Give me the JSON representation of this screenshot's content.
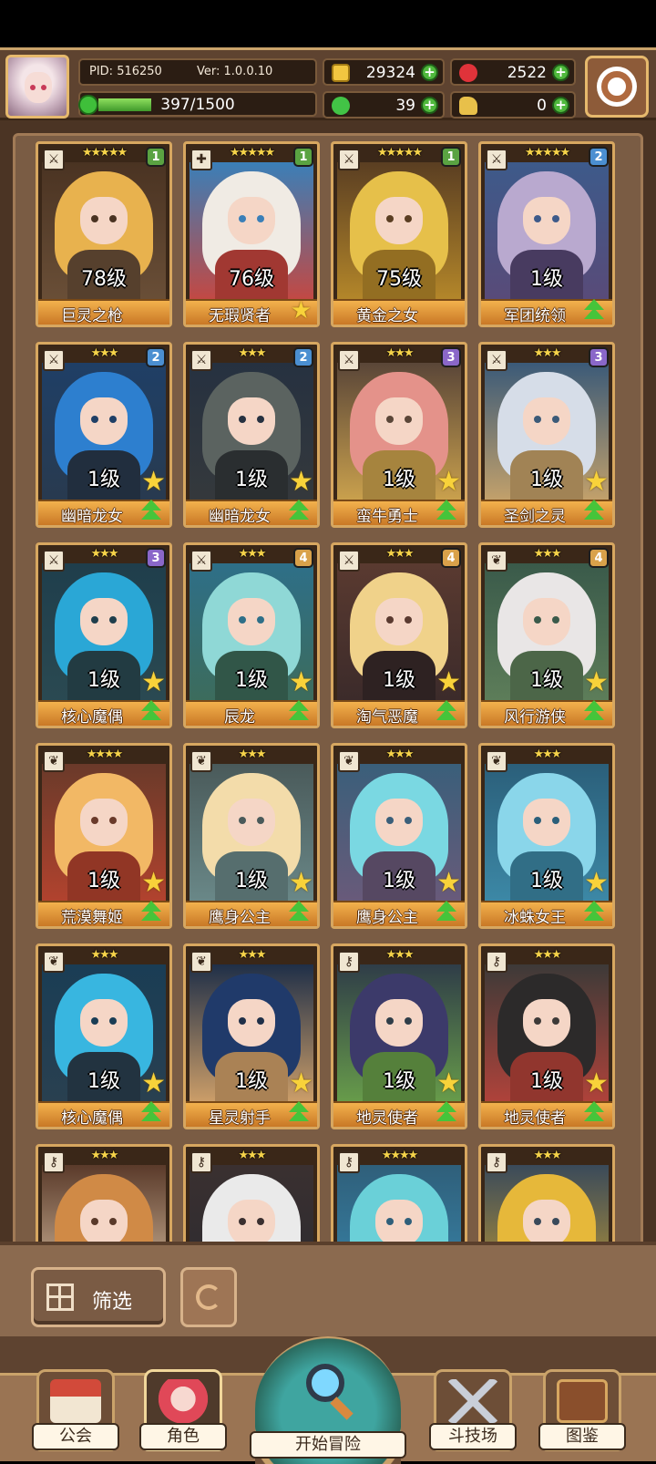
{
  "header": {
    "pid_label": "PID: 516250",
    "version_label": "Ver: 1.0.0.10",
    "xp": "397/1500",
    "xp_fraction": 0.265,
    "gold": "29324",
    "gems": "2522",
    "clover": "39",
    "fist": "0"
  },
  "cards": [
    {
      "name": "巨灵之枪",
      "level": "78级",
      "stars": "★★★★★",
      "rank": "1",
      "rank_color": "#5aa342",
      "type": "sword-icon",
      "palette": [
        "#4a3322",
        "#e8b24e",
        "#6b5038"
      ],
      "badge": "none"
    },
    {
      "name": "无瑕贤者",
      "level": "76级",
      "stars": "★★★★★",
      "rank": "1",
      "rank_color": "#5aa342",
      "type": "cross-icon",
      "palette": [
        "#3a7fb8",
        "#f0ebe4",
        "#c9463e"
      ],
      "badge": "crown"
    },
    {
      "name": "黄金之女",
      "level": "75级",
      "stars": "★★★★★",
      "rank": "1",
      "rank_color": "#5aa342",
      "type": "sword-icon",
      "palette": [
        "#5a3e22",
        "#e6c04a",
        "#b88a2a"
      ],
      "badge": "none"
    },
    {
      "name": "军团统领",
      "level": "1级",
      "stars": "★★★★★",
      "rank": "2",
      "rank_color": "#4b8fd1",
      "type": "sword-icon",
      "palette": [
        "#3d5a8a",
        "#b9a9cf",
        "#5a4a78"
      ],
      "badge": "up"
    },
    {
      "name": "幽暗龙女",
      "level": "1级",
      "stars": "★★★",
      "rank": "2",
      "rank_color": "#4b8fd1",
      "type": "sword-icon",
      "palette": [
        "#1f3f66",
        "#2d7fcf",
        "#293a4e"
      ],
      "badge": "both"
    },
    {
      "name": "幽暗龙女",
      "level": "1级",
      "stars": "★★★",
      "rank": "2",
      "rank_color": "#4b8fd1",
      "type": "sword-icon",
      "palette": [
        "#263140",
        "#5b6360",
        "#35393c"
      ],
      "badge": "both"
    },
    {
      "name": "蛮牛勇士",
      "level": "1级",
      "stars": "★★★",
      "rank": "3",
      "rank_color": "#8a67c9",
      "type": "sword-icon",
      "palette": [
        "#5a4638",
        "#e4928a",
        "#cfa54e"
      ],
      "badge": "both"
    },
    {
      "name": "圣剑之灵",
      "level": "1级",
      "stars": "★★★",
      "rank": "3",
      "rank_color": "#8a67c9",
      "type": "sword-icon",
      "palette": [
        "#3b5a78",
        "#d6dde8",
        "#c9a46a"
      ],
      "badge": "both"
    },
    {
      "name": "核心魔偶",
      "level": "1级",
      "stars": "★★★",
      "rank": "3",
      "rank_color": "#8a67c9",
      "type": "sword-icon",
      "palette": [
        "#1f3e4c",
        "#2aa7d6",
        "#2b4a52"
      ],
      "badge": "both"
    },
    {
      "name": "辰龙",
      "level": "1级",
      "stars": "★★★",
      "rank": "4",
      "rank_color": "#d9a14a",
      "type": "sword-icon",
      "palette": [
        "#2e6f88",
        "#8fd8d6",
        "#3d6c5a"
      ],
      "badge": "both"
    },
    {
      "name": "淘气恶魔",
      "level": "1级",
      "stars": "★★★",
      "rank": "4",
      "rank_color": "#d9a14a",
      "type": "sword-icon",
      "palette": [
        "#5a3a30",
        "#f0d28a",
        "#3a2a2a"
      ],
      "badge": "both"
    },
    {
      "name": "风行游侠",
      "level": "1级",
      "stars": "★★★",
      "rank": "4",
      "rank_color": "#d9a14a",
      "type": "leaf-icon",
      "palette": [
        "#3a5a4a",
        "#e9e6e6",
        "#5f7f5a"
      ],
      "badge": "both"
    },
    {
      "name": "荒漠舞姬",
      "level": "1级",
      "stars": "★★★★",
      "rank": "",
      "rank_color": "",
      "type": "leaf-icon",
      "palette": [
        "#6a3a2a",
        "#f2b865",
        "#b5432e"
      ],
      "badge": "both"
    },
    {
      "name": "鹰身公主",
      "level": "1级",
      "stars": "★★★",
      "rank": "",
      "rank_color": "",
      "type": "leaf-icon",
      "palette": [
        "#4a5a5a",
        "#f3dcaa",
        "#6b8a8a"
      ],
      "badge": "both"
    },
    {
      "name": "鹰身公主",
      "level": "1级",
      "stars": "★★★",
      "rank": "",
      "rank_color": "",
      "type": "leaf-icon",
      "palette": [
        "#3a5f7a",
        "#7ad8e2",
        "#6b5a7a"
      ],
      "badge": "both"
    },
    {
      "name": "冰蛛女王",
      "level": "1级",
      "stars": "★★★",
      "rank": "",
      "rank_color": "",
      "type": "leaf-icon",
      "palette": [
        "#2b5f7a",
        "#8ad6ea",
        "#3d8aa8"
      ],
      "badge": "both"
    },
    {
      "name": "核心魔偶",
      "level": "1级",
      "stars": "★★★",
      "rank": "",
      "rank_color": "",
      "type": "leaf-icon",
      "palette": [
        "#1a3d55",
        "#38b6e0",
        "#2a4050"
      ],
      "badge": "both"
    },
    {
      "name": "星灵射手",
      "level": "1级",
      "stars": "★★★",
      "rank": "",
      "rank_color": "",
      "type": "leaf-icon",
      "palette": [
        "#1f2f48",
        "#203a6a",
        "#d4a36a"
      ],
      "badge": "both"
    },
    {
      "name": "地灵使者",
      "level": "1级",
      "stars": "★★★",
      "rank": "",
      "rank_color": "",
      "type": "key-icon",
      "palette": [
        "#2f3d48",
        "#3c3a6a",
        "#6aa04a"
      ],
      "badge": "both"
    },
    {
      "name": "地灵使者",
      "level": "1级",
      "stars": "★★★",
      "rank": "",
      "rank_color": "",
      "type": "key-icon",
      "palette": [
        "#3d3a38",
        "#2c2a2a",
        "#b5433a"
      ],
      "badge": "both"
    },
    {
      "name": "",
      "level": "",
      "stars": "★★★",
      "rank": "",
      "rank_color": "",
      "type": "key-icon",
      "palette": [
        "#5a3a2a",
        "#d08a46",
        "#e8d0b0"
      ],
      "badge": "none"
    },
    {
      "name": "",
      "level": "",
      "stars": "★★★",
      "rank": "",
      "rank_color": "",
      "type": "key-icon",
      "palette": [
        "#3a3030",
        "#eaeaea",
        "#2a2a30"
      ],
      "badge": "none"
    },
    {
      "name": "",
      "level": "",
      "stars": "★★★★",
      "rank": "",
      "rank_color": "",
      "type": "key-icon",
      "palette": [
        "#2f5f7a",
        "#6ad0d8",
        "#3a8ab0"
      ],
      "badge": "none"
    },
    {
      "name": "",
      "level": "",
      "stars": "★★★",
      "rank": "",
      "rank_color": "",
      "type": "key-icon",
      "palette": [
        "#3a4a5a",
        "#e6b83a",
        "#caa030"
      ],
      "badge": "none"
    }
  ],
  "controls": {
    "filter_label": "筛选"
  },
  "nav": [
    {
      "label": "公会",
      "icon": "guild-hall-icon"
    },
    {
      "label": "角色",
      "icon": "character-icon"
    },
    {
      "label": "开始冒险",
      "icon": "adventure-magnifier-icon"
    },
    {
      "label": "斗技场",
      "icon": "crossed-swords-icon"
    },
    {
      "label": "图鉴",
      "icon": "book-icon"
    }
  ]
}
